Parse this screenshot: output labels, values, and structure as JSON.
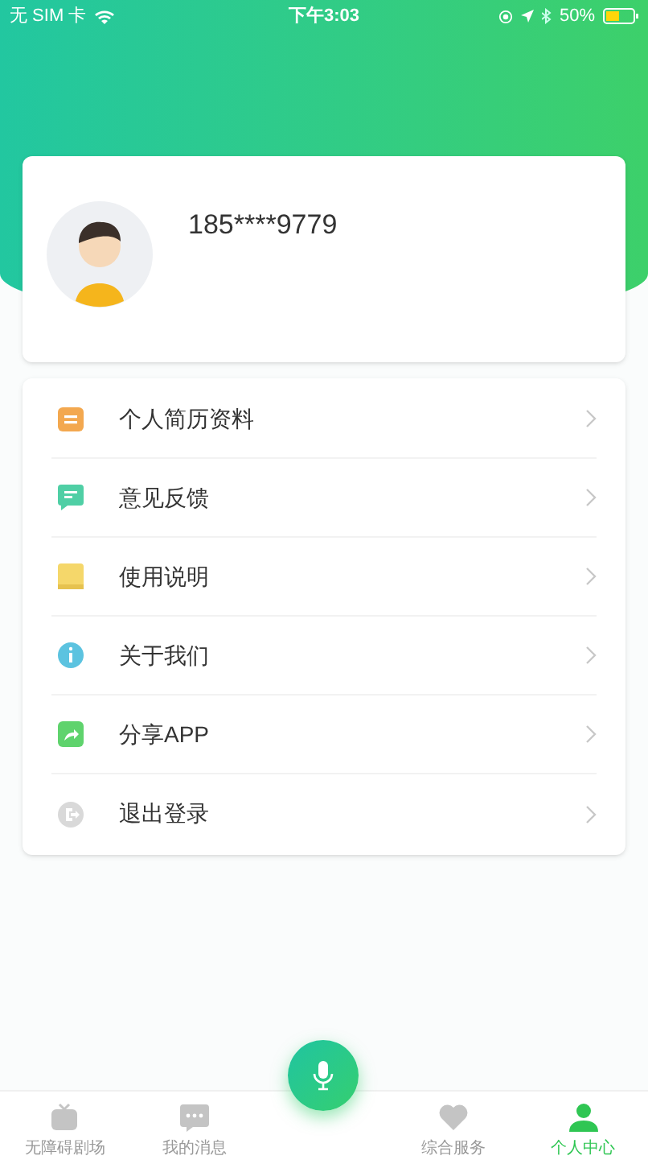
{
  "status_bar": {
    "carrier": "无 SIM 卡",
    "time": "下午3:03",
    "battery": "50%"
  },
  "profile": {
    "phone": "185****9779"
  },
  "menu": [
    {
      "kind": "resume",
      "label": "个人简历资料",
      "color": "#f3a84f"
    },
    {
      "kind": "feedback",
      "label": "意见反馈",
      "color": "#4fcfa5"
    },
    {
      "kind": "guide",
      "label": "使用说明",
      "color": "#f5d76a"
    },
    {
      "kind": "about",
      "label": "关于我们",
      "color": "#5cc3e0"
    },
    {
      "kind": "share",
      "label": "分享APP",
      "color": "#5fd36d"
    },
    {
      "kind": "logout",
      "label": "退出登录",
      "color": "#d9d9d9"
    }
  ],
  "tabs": [
    {
      "kind": "tv",
      "label": "无障碍剧场",
      "selected": false
    },
    {
      "kind": "chat",
      "label": "我的消息",
      "selected": false
    },
    {
      "kind": "mic"
    },
    {
      "kind": "heart",
      "label": "综合服务",
      "selected": false
    },
    {
      "kind": "person",
      "label": "个人中心",
      "selected": true
    }
  ]
}
